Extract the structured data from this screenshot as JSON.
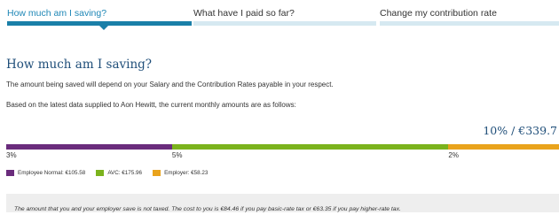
{
  "tabs": [
    {
      "label": "How much am I saving?",
      "active": true
    },
    {
      "label": "What have I paid so far?",
      "active": false
    },
    {
      "label": "Change my contribution rate",
      "active": false
    }
  ],
  "main": {
    "heading": "How much am I saving?",
    "intro": "The amount being saved will depend on your Salary and the Contribution Rates payable in your respect.",
    "basis": "Based on the latest data supplied to Aon Hewitt, the current monthly amounts are as follows:",
    "total_label": "10% / €339.7"
  },
  "contribution_bar": {
    "segments": [
      {
        "name": "employee-normal",
        "percent": 3,
        "color": "#6a2c7c"
      },
      {
        "name": "avc",
        "percent": 5,
        "color": "#7bb31d"
      },
      {
        "name": "employer",
        "percent": 2,
        "color": "#e9a31c"
      }
    ],
    "labels": [
      "3%",
      "5%",
      "2%"
    ]
  },
  "legend": [
    {
      "label": "Employee Normal: €105.58",
      "color": "#6a2c7c"
    },
    {
      "label": "AVC: €175.96",
      "color": "#7bb31d"
    },
    {
      "label": "Employer: €58.23",
      "color": "#e9a31c"
    }
  ],
  "note": "The amount that you and your employer save is not taxed. The cost to you is €84.46 if you pay basic-rate tax or €63.35 if you pay higher-rate tax."
}
